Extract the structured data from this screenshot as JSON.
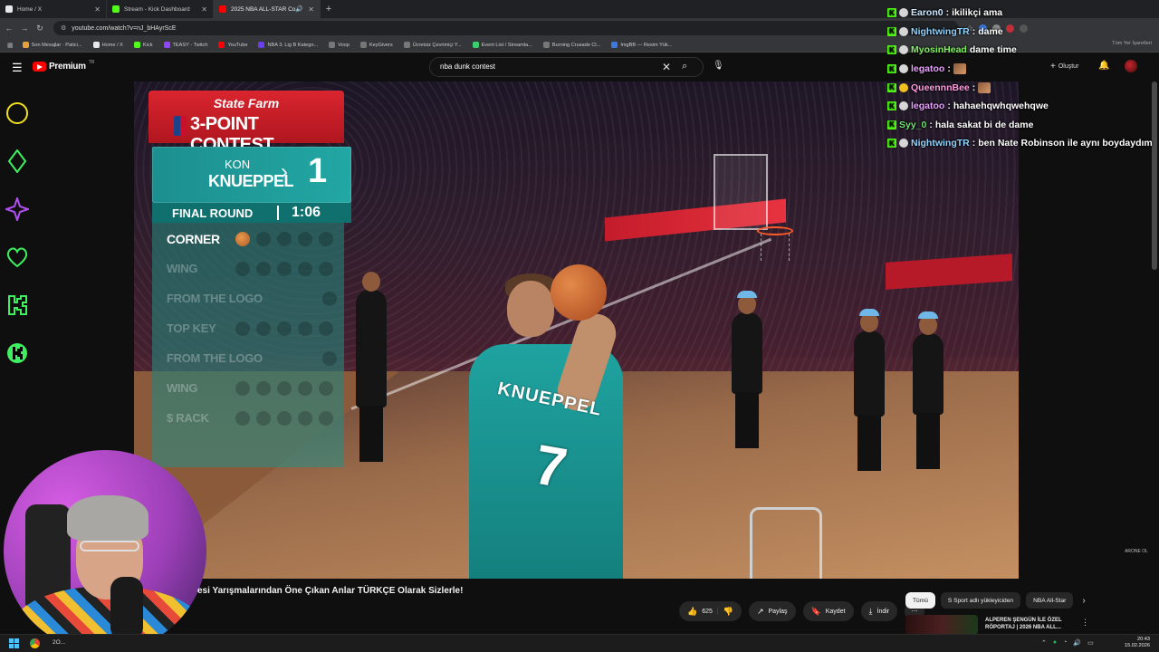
{
  "browser": {
    "tabs": [
      {
        "label": "Home / X",
        "color": "#e7e9ea"
      },
      {
        "label": "Stream - Kick Dashboard",
        "color": "#53fc18"
      },
      {
        "label": "2025 NBA ALL-STAR Co...",
        "color": "#ff0000",
        "active": true
      }
    ],
    "new_tab": "+",
    "url": "youtube.com/watch?v=nJ_bHAyrScE",
    "bookmarks": [
      {
        "label": "Son Mesajlar · Patici...",
        "color": "#e8a03a"
      },
      {
        "label": "Home / X",
        "color": "#e7e9ea"
      },
      {
        "label": "Kick",
        "color": "#53fc18"
      },
      {
        "label": "TEASY - Twitch",
        "color": "#9146ff"
      },
      {
        "label": "YouTube",
        "color": "#ff0000"
      },
      {
        "label": "NBA 3. Lig B Katego...",
        "color": "#6a3df0"
      },
      {
        "label": "Voop",
        "color": "#777777"
      },
      {
        "label": "KeyGivers",
        "color": "#777777"
      },
      {
        "label": "Ücretsiz Çevrimiçi Y...",
        "color": "#777777"
      },
      {
        "label": "Event List / Streamla...",
        "color": "#3acf6a"
      },
      {
        "label": "Burning Crusade Cl...",
        "color": "#777777"
      },
      {
        "label": "ImgBB — Resim Yük...",
        "color": "#3a7adf"
      }
    ],
    "all_bookmarks": "Tüm Yer İşaretleri"
  },
  "youtube": {
    "logo_text": "Premium",
    "logo_sup": "TR",
    "search_value": "nba dunk contest",
    "create_label": "Oluştur",
    "video_title": "esi Yarışmalarından Öne Çıkan Anlar TÜRKÇE Olarak Sizlerle!",
    "like_count": "625",
    "share_label": "Paylaş",
    "save_label": "Kaydet",
    "download_label": "İndir",
    "chips": [
      "Tümü",
      "S Sport adlı yükleyiciden",
      "NBA All-Star"
    ],
    "rec_title": "ALPEREN ŞENGÜN İLE ÖZEL RÖPORTAJ | 2026 NBA ALL...",
    "watermark": "ARONE OL"
  },
  "scoreboard": {
    "sponsor": "State Farm",
    "event": "3-POINT CONTEST",
    "first_name": "KON",
    "last_name": "KNUEPPEL",
    "score": "1",
    "round": "FINAL ROUND",
    "time": "1:06",
    "racks": [
      {
        "name": "CORNER",
        "made": [
          1,
          0,
          0,
          0,
          0
        ],
        "current": true
      },
      {
        "name": "WING",
        "made": [
          0,
          0,
          0,
          0,
          0
        ]
      },
      {
        "name": "FROM THE LOGO",
        "made": [
          0
        ],
        "logo": true
      },
      {
        "name": "TOP KEY",
        "made": [
          0,
          0,
          0,
          0,
          0
        ]
      },
      {
        "name": "FROM THE LOGO",
        "made": [
          0
        ],
        "logo": true
      },
      {
        "name": "WING",
        "made": [
          0,
          0,
          0,
          0,
          0
        ]
      },
      {
        "name": "$ RACK",
        "made": [
          0,
          0,
          0,
          0,
          0
        ]
      }
    ]
  },
  "jersey": {
    "name": "KNUEPPEL",
    "number": "7"
  },
  "chat": [
    {
      "user": "Earon0",
      "color": "#cfe8ff",
      "text": "ikilikçi ama"
    },
    {
      "user": "NightwingTR",
      "color": "#8fd3ff",
      "text": "dame"
    },
    {
      "user": "MyosinHead",
      "color": "#80f060",
      "text": "dame time",
      "no_colon": true
    },
    {
      "user": "legatoo",
      "color": "#e8a0ff",
      "text": "",
      "emote": true
    },
    {
      "user": "QueennnBee",
      "color": "#ff9adf",
      "text": "",
      "emote": true,
      "gold": true
    },
    {
      "user": "legatoo",
      "color": "#e8a0ff",
      "text": "hahaehqwhqwehqwe"
    },
    {
      "user": "Syy_0",
      "color": "#70e070",
      "text": "hala sakat bi de dame",
      "no_badge2": true
    },
    {
      "user": "NightwingTR",
      "color": "#8fd3ff",
      "text": "ben Nate Robinson ile aynı boydaydım"
    }
  ],
  "taskbar": {
    "app_label": "2O...",
    "time": "20:43",
    "date": "15.02.2026"
  }
}
